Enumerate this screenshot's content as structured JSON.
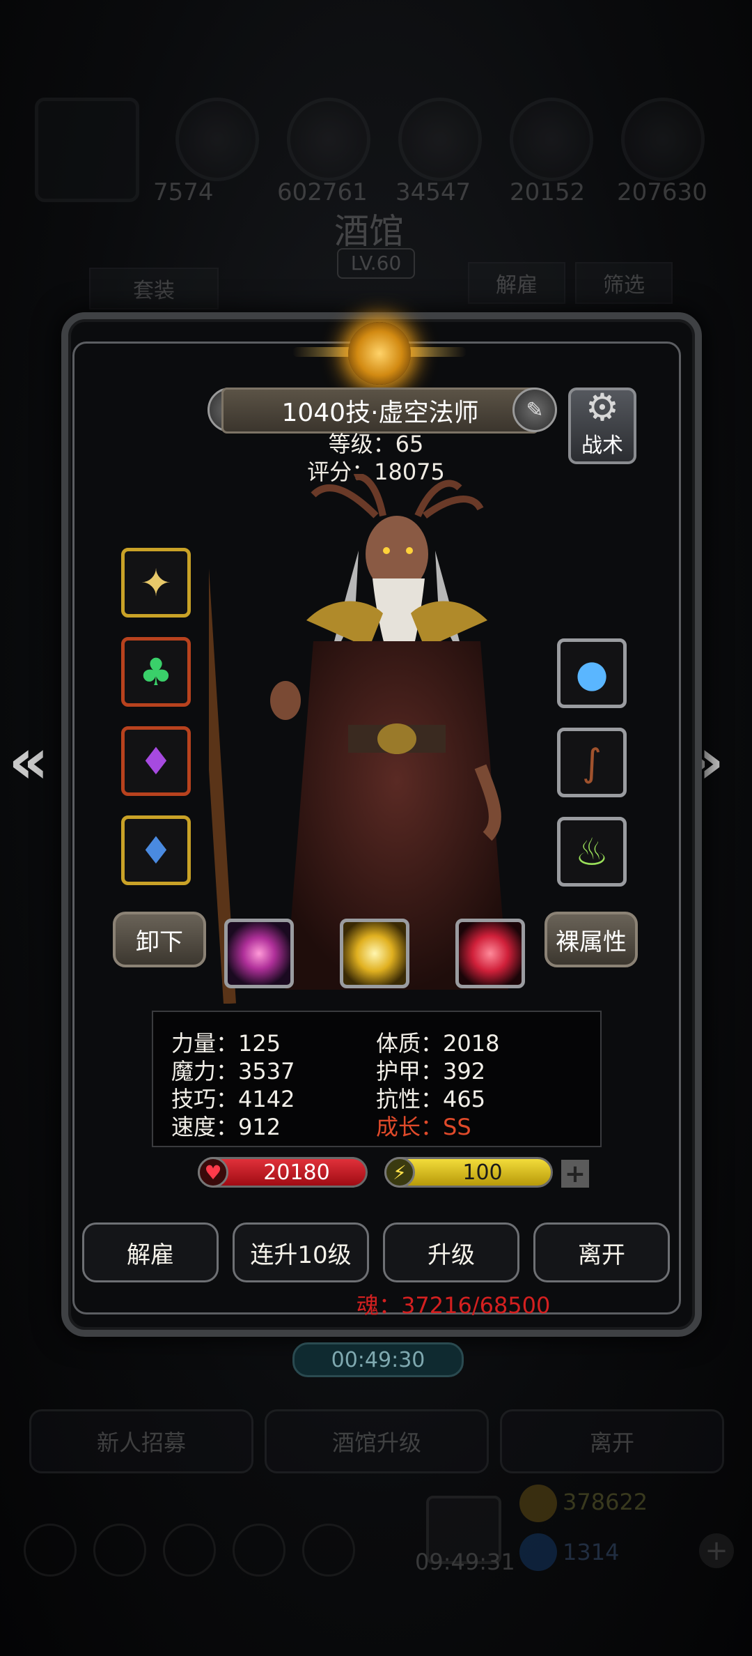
{
  "background": {
    "resources": [
      "7574",
      "602761",
      "34547",
      "20152",
      "207630"
    ],
    "title": "酒馆",
    "level": "LV.60",
    "tab_set": "套装",
    "tab_fire": "解雇",
    "tab_filter": "筛选",
    "bottom_buttons": [
      "新人招募",
      "酒馆升级",
      "离开"
    ],
    "gold": "378622",
    "gems": "1314",
    "clock": "09:49:31"
  },
  "hero": {
    "name": "1040技·虚空法师",
    "level_line": "等级：65",
    "score_line": "评分：18075",
    "tactics_label": "战术",
    "unequip_label": "卸下",
    "bare_attr_label": "裸属性"
  },
  "stats": {
    "strength": "力量：125",
    "magic": "魔力：3537",
    "skill": "技巧：4142",
    "speed": "速度：912",
    "constitution": "体质：2018",
    "armor": "护甲：392",
    "resistance": "抗性：465",
    "growth": "成长：SS"
  },
  "bars": {
    "hp": "20180",
    "energy": "100",
    "plus": "+"
  },
  "actions": {
    "fire": "解雇",
    "upgrade10": "连升10级",
    "upgrade": "升级",
    "leave": "离开"
  },
  "soul": "魂：37216/68500",
  "timer": "00:49:30",
  "icons": {
    "left_arrow": "«",
    "right_arrow": "»",
    "gear": "⚙",
    "edit": "✎",
    "settings": "⚙"
  },
  "colors": {
    "hp_bar": "#c0141a",
    "energy_bar": "#d9c21a",
    "soul_text": "#d42020",
    "growth_text": "#e04a2a"
  }
}
